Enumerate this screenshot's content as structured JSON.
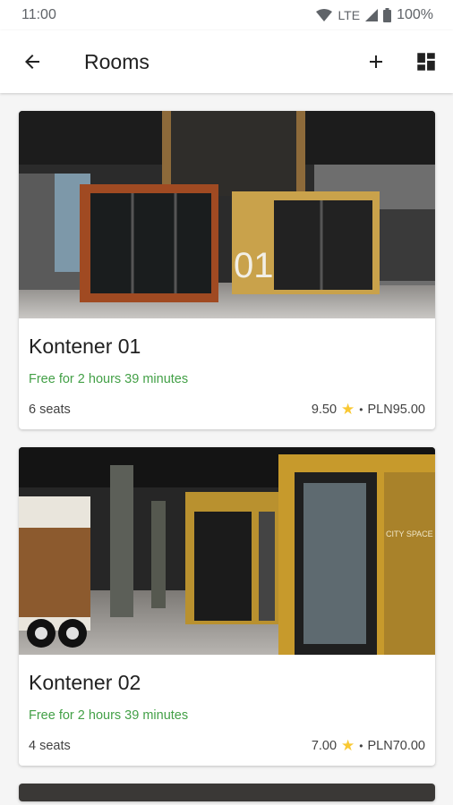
{
  "status_bar": {
    "time": "11:00",
    "network": "LTE",
    "battery": "100%"
  },
  "app_bar": {
    "title": "Rooms"
  },
  "rooms": [
    {
      "name": "Kontener 01",
      "availability": "Free for 2 hours 39 minutes",
      "seats": "6 seats",
      "rating": "9.50",
      "price": "PLN95.00",
      "sign": "01"
    },
    {
      "name": "Kontener 02",
      "availability": "Free for 2 hours 39 minutes",
      "seats": "4 seats",
      "rating": "7.00",
      "price": "PLN70.00",
      "sign": "CITY SPACE CLUB"
    }
  ],
  "colors": {
    "accent_green": "#43a047",
    "star": "#f9c833"
  },
  "icons": [
    "arrow-back-icon",
    "add-icon",
    "dashboard-icon",
    "wifi-icon",
    "signal-icon",
    "battery-icon",
    "star-icon"
  ]
}
